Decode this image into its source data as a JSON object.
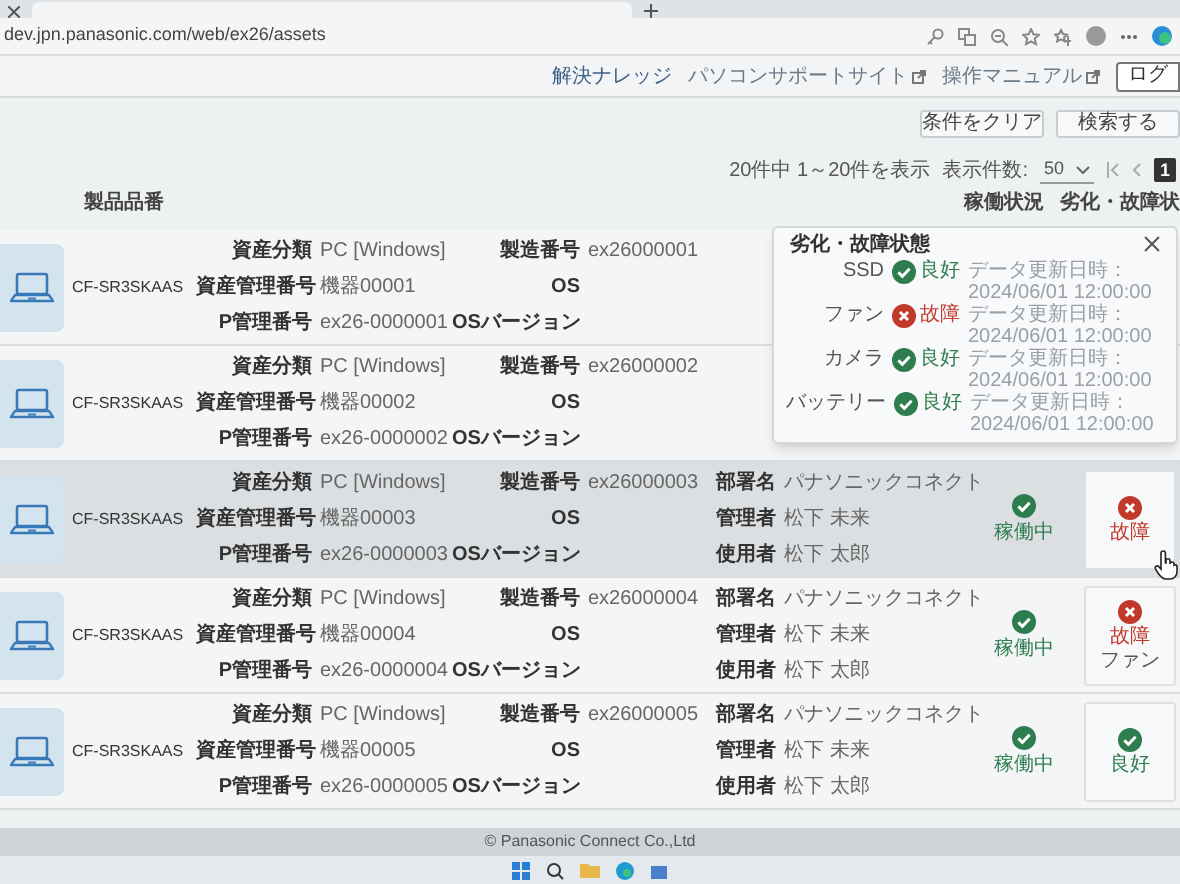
{
  "browser": {
    "url": "dev.jpn.panasonic.com/web/ex26/assets"
  },
  "header_links": [
    {
      "label": "解決ナレッジ",
      "external": false
    },
    {
      "label": "パソコンサポートサイト",
      "external": true
    },
    {
      "label": "操作マニュアル",
      "external": true
    }
  ],
  "login_button": "ログ",
  "search_buttons": [
    "条件をクリア",
    "検索する"
  ],
  "pager": {
    "summary": "20件中 1～20件を表示",
    "per_page_label": "表示件数:",
    "per_page": "50",
    "pages": [
      {
        "label": "1",
        "selected": true
      }
    ]
  },
  "columns": {
    "product": "製品品番",
    "operation": "稼働状況",
    "condition": "劣化・故障状"
  },
  "rows": [
    {
      "model": "CF-SR3SKAAS",
      "highlighted": false,
      "groups": [
        [
          {
            "label": "資産分類",
            "value": "PC [Windows]"
          },
          {
            "label": "資産管理番号",
            "value": "機器00001"
          },
          {
            "label": "P管理番号",
            "value": "ex26-0000001"
          }
        ],
        [
          {
            "label": "製造番号",
            "value": "ex26000001"
          },
          {
            "label": "OS"
          },
          {
            "label": "OSバージョン"
          }
        ]
      ]
    },
    {
      "model": "CF-SR3SKAAS",
      "highlighted": false,
      "groups": [
        [
          {
            "label": "資産分類",
            "value": "PC [Windows]"
          },
          {
            "label": "資産管理番号",
            "value": "機器00002"
          },
          {
            "label": "P管理番号",
            "value": "ex26-0000002"
          }
        ],
        [
          {
            "label": "製造番号",
            "value": "ex26000002"
          },
          {
            "label": "OS"
          },
          {
            "label": "OSバージョン"
          }
        ]
      ]
    },
    {
      "model": "CF-SR3SKAAS",
      "highlighted": true,
      "groups": [
        [
          {
            "label": "資産分類",
            "value": "PC [Windows]"
          },
          {
            "label": "資産管理番号",
            "value": "機器00003"
          },
          {
            "label": "P管理番号",
            "value": "ex26-0000003"
          }
        ],
        [
          {
            "label": "製造番号",
            "value": "ex26000003"
          },
          {
            "label": "OS"
          },
          {
            "label": "OSバージョン"
          }
        ],
        [
          {
            "label": "部署名",
            "value": "パナソニックコネクト"
          },
          {
            "label": "管理者",
            "value": "松下 未来"
          },
          {
            "label": "使用者",
            "value": "松下 太郎"
          }
        ]
      ],
      "operation": {
        "kind": "ok",
        "label": "稼働中"
      },
      "condition": {
        "kind": "fault",
        "label": "故障"
      }
    },
    {
      "model": "CF-SR3SKAAS",
      "highlighted": false,
      "groups": [
        [
          {
            "label": "資産分類",
            "value": "PC [Windows]"
          },
          {
            "label": "資産管理番号",
            "value": "機器00004"
          },
          {
            "label": "P管理番号",
            "value": "ex26-0000004"
          }
        ],
        [
          {
            "label": "製造番号",
            "value": "ex26000004"
          },
          {
            "label": "OS"
          },
          {
            "label": "OSバージョン"
          }
        ],
        [
          {
            "label": "部署名",
            "value": "パナソニックコネクト"
          },
          {
            "label": "管理者",
            "value": "松下 未来"
          },
          {
            "label": "使用者",
            "value": "松下 太郎"
          }
        ]
      ],
      "operation": {
        "kind": "ok",
        "label": "稼働中"
      },
      "condition": {
        "kind": "fault",
        "label": "故障",
        "part": "ファン"
      }
    },
    {
      "model": "CF-SR3SKAAS",
      "highlighted": false,
      "groups": [
        [
          {
            "label": "資産分類",
            "value": "PC [Windows]"
          },
          {
            "label": "資産管理番号",
            "value": "機器00005"
          },
          {
            "label": "P管理番号",
            "value": "ex26-0000005"
          }
        ],
        [
          {
            "label": "製造番号",
            "value": "ex26000005"
          },
          {
            "label": "OS"
          },
          {
            "label": "OSバージョン"
          }
        ],
        [
          {
            "label": "部署名",
            "value": "パナソニックコネクト"
          },
          {
            "label": "管理者",
            "value": "松下 未来"
          },
          {
            "label": "使用者",
            "value": "松下 太郎"
          }
        ]
      ],
      "operation": {
        "kind": "ok",
        "label": "稼働中"
      },
      "condition": {
        "kind": "ok",
        "label": "良好"
      }
    }
  ],
  "popup": {
    "title": "劣化・故障状態",
    "items": [
      {
        "part": "SSD",
        "kind": "ok",
        "status": "良好",
        "updated": "データ更新日時：2024/06/01 12:00:00"
      },
      {
        "part": "ファン",
        "kind": "fault",
        "status": "故障",
        "updated": "データ更新日時：2024/06/01 12:00:00"
      },
      {
        "part": "カメラ",
        "kind": "ok",
        "status": "良好",
        "updated": "データ更新日時：2024/06/01 12:00:00"
      },
      {
        "part": "バッテリー",
        "kind": "ok",
        "status": "良好",
        "updated": "データ更新日時：2024/06/01 12:00:00"
      }
    ]
  },
  "footer": "© Panasonic Connect Co.,Ltd"
}
